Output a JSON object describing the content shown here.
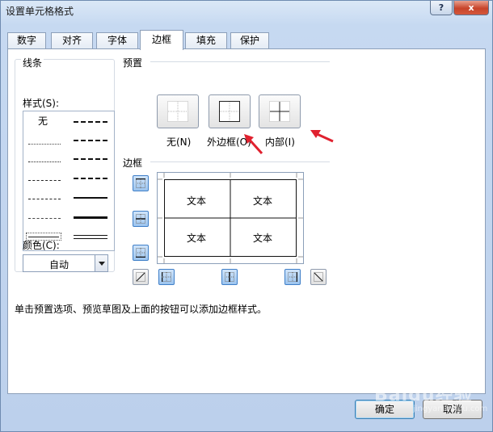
{
  "window": {
    "title": "设置单元格格式",
    "help": "?",
    "close": "x"
  },
  "tabs": [
    {
      "label": "数字",
      "active": false
    },
    {
      "label": "对齐",
      "active": false
    },
    {
      "label": "字体",
      "active": false
    },
    {
      "label": "边框",
      "active": true
    },
    {
      "label": "填充",
      "active": false
    },
    {
      "label": "保护",
      "active": false
    }
  ],
  "line_group": {
    "title": "线条",
    "style_label": "样式(S):",
    "none_label": "无",
    "color_label": "颜色(C):",
    "color_value": "自动"
  },
  "presets": {
    "title": "预置",
    "none": "无(N)",
    "outline": "外边框(O)",
    "inside": "内部(I)"
  },
  "border": {
    "title": "边框",
    "cells": [
      "文本",
      "文本",
      "文本",
      "文本"
    ]
  },
  "help_text": "单击预置选项、预览草图及上面的按钮可以添加边框样式。",
  "buttons": {
    "ok": "确定",
    "cancel": "取消"
  },
  "watermark": {
    "main": "Baidu经验",
    "sub": "jingyan.baidu.com"
  },
  "colors": {
    "accent_blue": "#3f7fc8",
    "arrow_red": "#e0212f"
  }
}
